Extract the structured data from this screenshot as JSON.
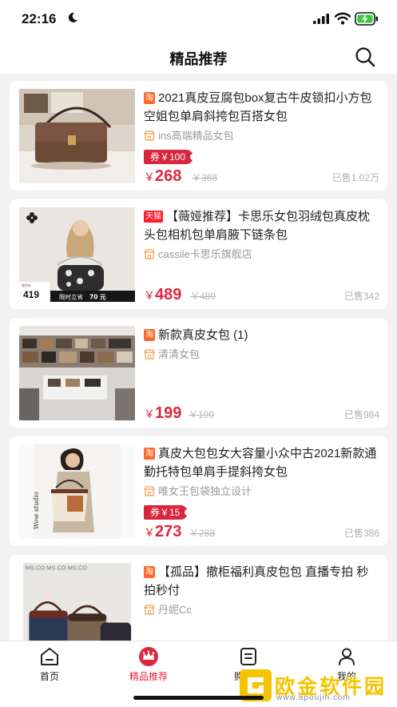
{
  "status": {
    "time": "22:16"
  },
  "header": {
    "title": "精品推荐"
  },
  "products": [
    {
      "platform": "淘",
      "title": "2021真皮豆腐包box复古牛皮锁扣小方包空姐包单肩斜挎包百搭女包",
      "shop": "ins高端精品女包",
      "coupon": "券￥100",
      "yen": "￥",
      "price": "268",
      "original": "￥368",
      "sold": "已售1.02万"
    },
    {
      "platform": "天猫",
      "title": "【薇娅推荐】卡思乐女包羽绒包真皮枕头包相机包单肩腋下链条包",
      "shop": "cassile卡思乐旗舰店",
      "yen": "￥",
      "price": "489",
      "original": "￥489",
      "sold": "已售342",
      "image_text": {
        "price_tag_small": "到手价",
        "price_tag": "419",
        "banner": "限时立省",
        "banner_value": "70 元"
      }
    },
    {
      "platform": "淘",
      "title": "新款真皮女包 (1)",
      "shop": "清清女包",
      "yen": "￥",
      "price": "199",
      "original": "￥199",
      "sold": "已售984"
    },
    {
      "platform": "淘",
      "title": "真皮大包包女大容量小众中古2021新款通勤托特包单肩手提斜挎女包",
      "shop": "唯女王包袋独立设计",
      "coupon": "券￥15",
      "yen": "￥",
      "price": "273",
      "original": "￥288",
      "sold": "已售386",
      "image_text": {
        "signature": "Wow studio"
      }
    },
    {
      "platform": "淘",
      "title": "【孤品】撤柜福利真皮包包 直播专拍 秒拍秒付",
      "shop": "丹妮Cc",
      "image_text": {
        "wall_text": "MS.CO  MS.CO  MS.CO"
      }
    }
  ],
  "tabbar": {
    "items": [
      {
        "label": "首页"
      },
      {
        "label": "精品推荐"
      },
      {
        "label": "购物车"
      },
      {
        "label": "我的"
      }
    ]
  },
  "watermark": {
    "text": "欧金软件园",
    "url": "www.apoujin.com"
  },
  "colors": {
    "accent": "#e0263f",
    "tag_taobao": "#ff6a2a",
    "tag_tmall": "#ff1c2e",
    "coupon": "#d7263d"
  }
}
